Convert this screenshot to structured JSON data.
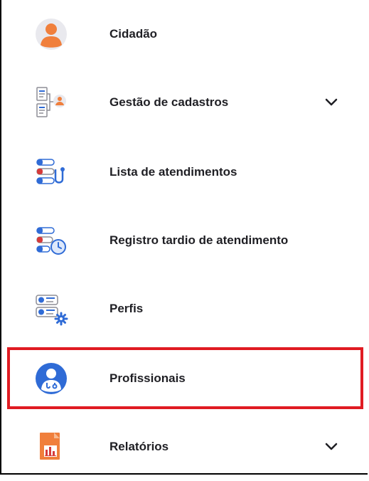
{
  "menu": {
    "items": [
      {
        "label": "Cidadão",
        "icon": "citizen-icon",
        "expandable": false
      },
      {
        "label": "Gestão de cadastros",
        "icon": "registration-management-icon",
        "expandable": true
      },
      {
        "label": "Lista de atendimentos",
        "icon": "appointments-list-icon",
        "expandable": false
      },
      {
        "label": "Registro tardio de atendimento",
        "icon": "late-registration-icon",
        "expandable": false
      },
      {
        "label": "Perfis",
        "icon": "profiles-icon",
        "expandable": false
      },
      {
        "label": "Profissionais",
        "icon": "professionals-icon",
        "expandable": false,
        "highlighted": true
      },
      {
        "label": "Relatórios",
        "icon": "reports-icon",
        "expandable": true
      }
    ]
  },
  "colors": {
    "highlight_border": "#e01b22",
    "icon_blue": "#2f6bd6",
    "icon_orange": "#f07f3c",
    "text": "#1f1f24"
  }
}
